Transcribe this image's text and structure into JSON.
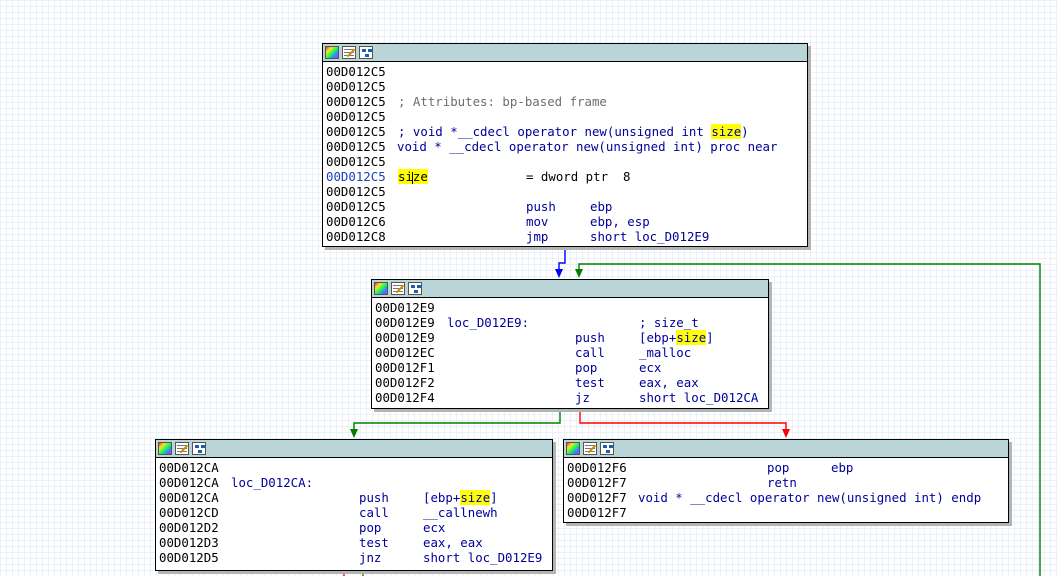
{
  "blocks": {
    "entry": {
      "lines": [
        {
          "addr": "00D012C5"
        },
        {
          "addr": "00D012C5"
        },
        {
          "addr": "00D012C5",
          "comment": "; Attributes: bp-based frame"
        },
        {
          "addr": "00D012C5"
        },
        {
          "addr": "00D012C5",
          "proto_prefix": "; void *__cdecl operator new(unsigned int ",
          "proto_hl": "size",
          "proto_suffix": ")"
        },
        {
          "addr": "00D012C5",
          "proc": "void * __cdecl operator new(unsigned int) proc near"
        },
        {
          "addr": "00D012C5"
        },
        {
          "addr": "00D012C5",
          "var_a": "si",
          "var_b": "ze",
          "var_def": "= dword ptr  8"
        },
        {
          "addr": "00D012C5"
        },
        {
          "addr": "00D012C5",
          "mnem": "push",
          "op": "ebp"
        },
        {
          "addr": "00D012C6",
          "mnem": "mov",
          "op": "ebp, esp"
        },
        {
          "addr": "00D012C8",
          "mnem": "jmp",
          "op": "short loc_D012E9"
        }
      ]
    },
    "loop": {
      "lines": [
        {
          "addr": "00D012E9"
        },
        {
          "addr": "00D012E9",
          "label": "loc_D012E9:",
          "comment": "; size_t"
        },
        {
          "addr": "00D012E9",
          "mnem": "push",
          "op_prefix": "[ebp+",
          "op_hl": "size",
          "op_suffix": "]"
        },
        {
          "addr": "00D012EC",
          "mnem": "call",
          "op_call": "_malloc"
        },
        {
          "addr": "00D012F1",
          "mnem": "pop",
          "op": "ecx"
        },
        {
          "addr": "00D012F2",
          "mnem": "test",
          "op": "eax, eax"
        },
        {
          "addr": "00D012F4",
          "mnem": "jz",
          "op": "short loc_D012CA"
        }
      ]
    },
    "left": {
      "lines": [
        {
          "addr": "00D012CA"
        },
        {
          "addr": "00D012CA",
          "label": "loc_D012CA:"
        },
        {
          "addr": "00D012CA",
          "mnem": "push",
          "op_prefix": "[ebp+",
          "op_hl": "size",
          "op_suffix": "]"
        },
        {
          "addr": "00D012CD",
          "mnem": "call",
          "op_call": "__callnewh"
        },
        {
          "addr": "00D012D2",
          "mnem": "pop",
          "op": "ecx"
        },
        {
          "addr": "00D012D3",
          "mnem": "test",
          "op": "eax, eax"
        },
        {
          "addr": "00D012D5",
          "mnem": "jnz",
          "op": "short loc_D012E9"
        }
      ]
    },
    "right": {
      "lines": [
        {
          "addr": "00D012F6",
          "mnem": "pop",
          "op": "ebp"
        },
        {
          "addr": "00D012F7",
          "mnem": "retn"
        },
        {
          "addr": "00D012F7",
          "proc": "void * __cdecl operator new(unsigned int) endp"
        },
        {
          "addr": "00D012F7"
        }
      ]
    }
  },
  "colors": {
    "edge_unconditional": "#0000ff",
    "edge_true": "#008000",
    "edge_false": "#ff0000",
    "node_header": "#b9d5d8",
    "highlight": "#ffff00",
    "annotation": "#ff0000"
  },
  "icons": [
    "color-palette-icon",
    "edit-text-icon",
    "graph-overview-icon"
  ]
}
